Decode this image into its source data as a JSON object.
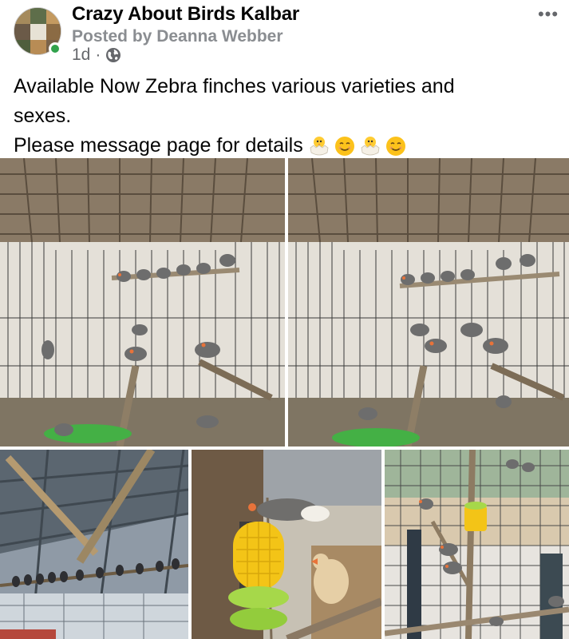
{
  "post": {
    "page_name": "Crazy About Birds Kalbar",
    "posted_by": "Posted by Deanna Webber",
    "time": "1d",
    "separator": "·",
    "more_label": "•••",
    "text_line1": "Available Now Zebra finches various varieties and",
    "text_line2": "sexes.",
    "text_line3": "Please message page for details"
  },
  "icons": {
    "avatar": "page-avatar",
    "online": "online-status-dot",
    "audience": "globe-icon",
    "more": "more-options-icon",
    "emojis": [
      "hatching-chick-emoji",
      "smiling-face-emoji",
      "hatching-chick-emoji",
      "smiling-face-emoji"
    ]
  },
  "photos": [
    {
      "subject": "zebra finches on perches in wire cage"
    },
    {
      "subject": "zebra finches on perches in wire cage"
    },
    {
      "subject": "finches perched under aviary roof"
    },
    {
      "subject": "zebra finches on corn cob feeder"
    },
    {
      "subject": "finches on branches in aviary"
    }
  ],
  "colors": {
    "name": "#050505",
    "secondary": "#65676b",
    "online": "#31a24c"
  }
}
